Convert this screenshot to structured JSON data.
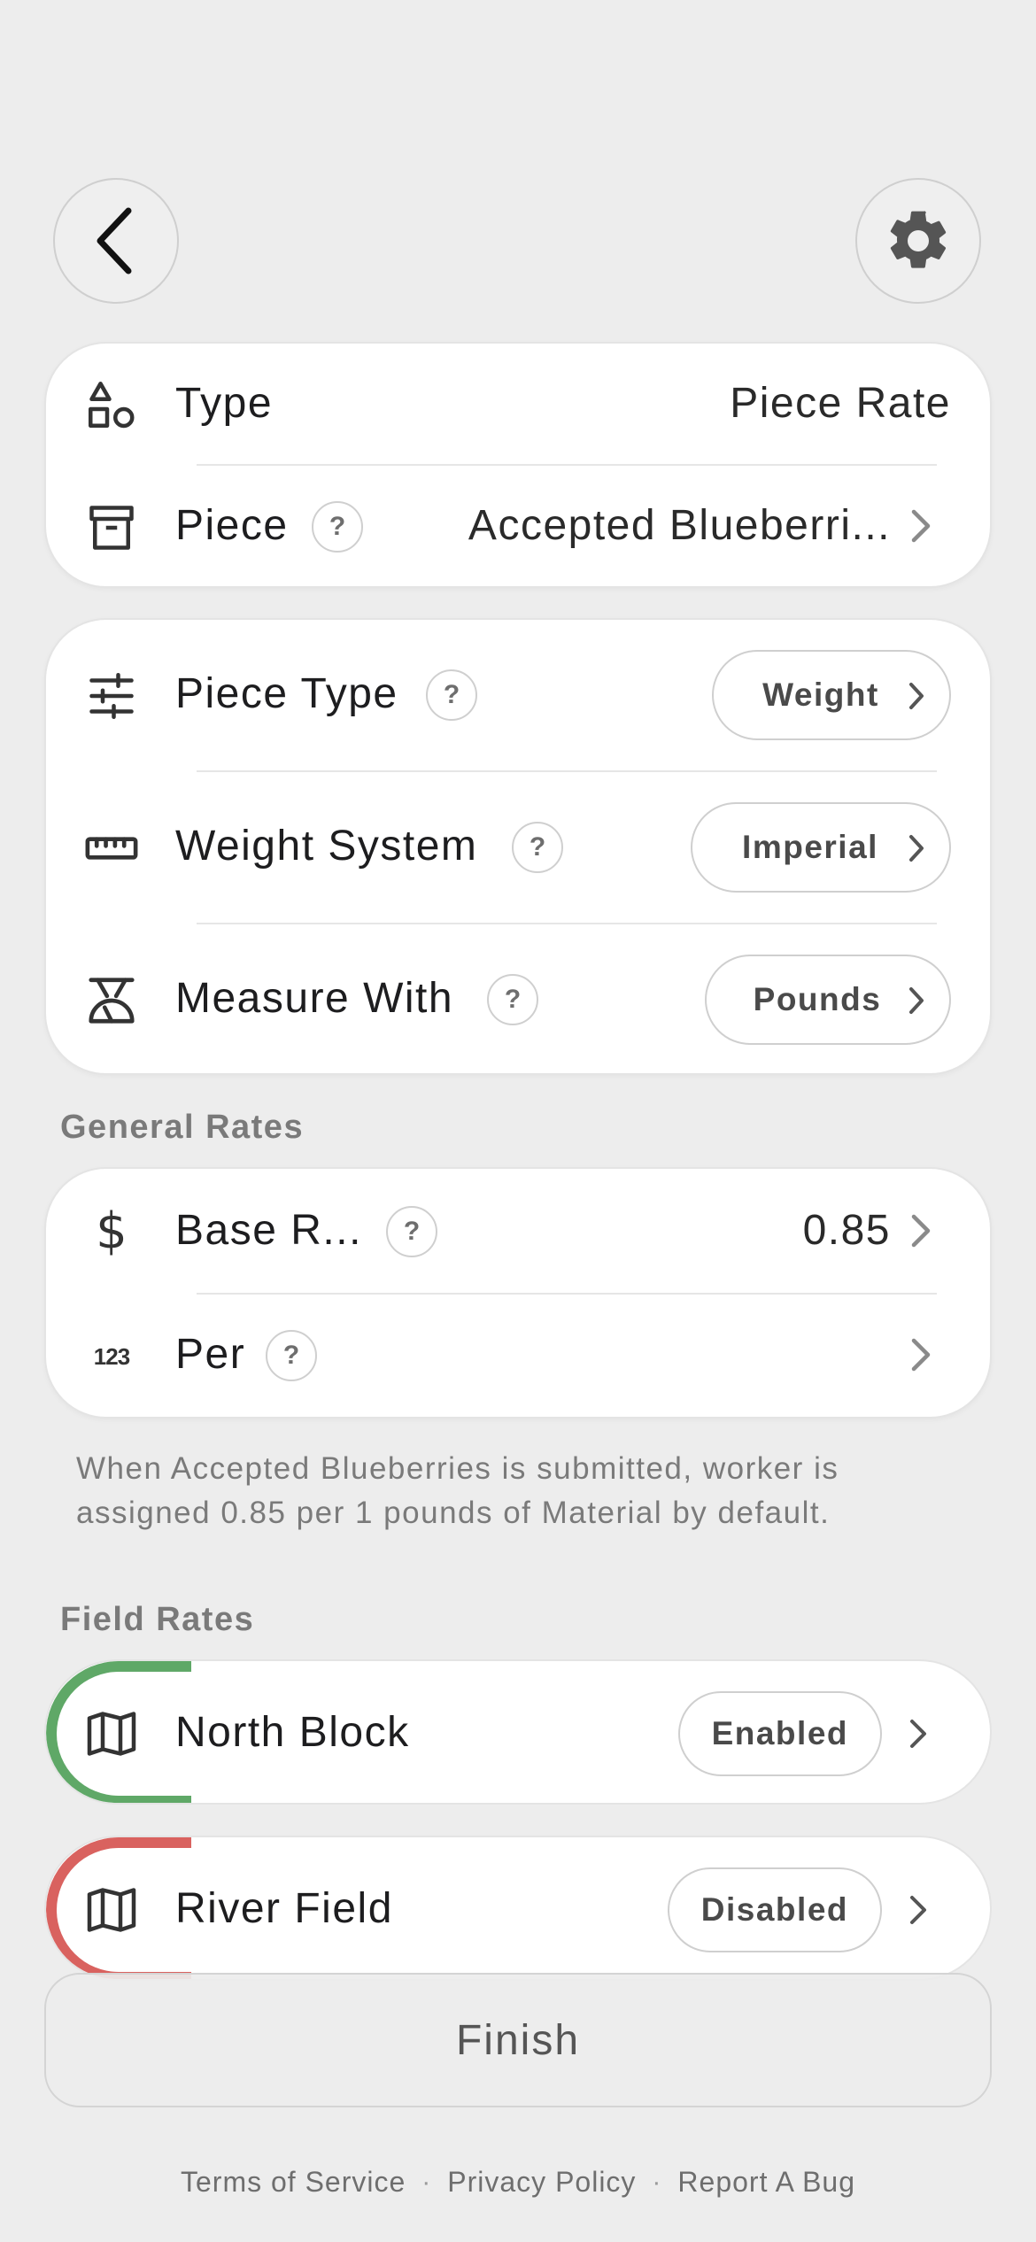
{
  "header": {
    "back_icon": "chevron-left-icon",
    "settings_icon": "gear-icon"
  },
  "rate_card": {
    "type_label": "Type",
    "type_value": "Piece Rate",
    "piece_label": "Piece",
    "piece_value": "Accepted Blueberri..."
  },
  "config_card": {
    "piece_type_label": "Piece Type",
    "piece_type_value": "Weight",
    "weight_system_label": "Weight System",
    "weight_system_value": "Imperial",
    "measure_with_label": "Measure With",
    "measure_with_value": "Pounds"
  },
  "general_rates": {
    "title": "General Rates",
    "base_rate_label": "Base R...",
    "base_rate_value": "0.85",
    "per_label": "Per",
    "description": "When Accepted Blueberries is submitted, worker is assigned 0.85 per 1 pounds of Material by default."
  },
  "field_rates": {
    "title": "Field Rates",
    "fields": [
      {
        "name": "North Block",
        "status": "Enabled",
        "color": "#5fa867"
      },
      {
        "name": "River Field",
        "status": "Disabled",
        "color": "#d9625f"
      }
    ]
  },
  "help_mark": "?",
  "finish_label": "Finish",
  "footer": {
    "terms": "Terms of Service",
    "privacy": "Privacy Policy",
    "report": "Report A Bug",
    "separator": "·"
  }
}
